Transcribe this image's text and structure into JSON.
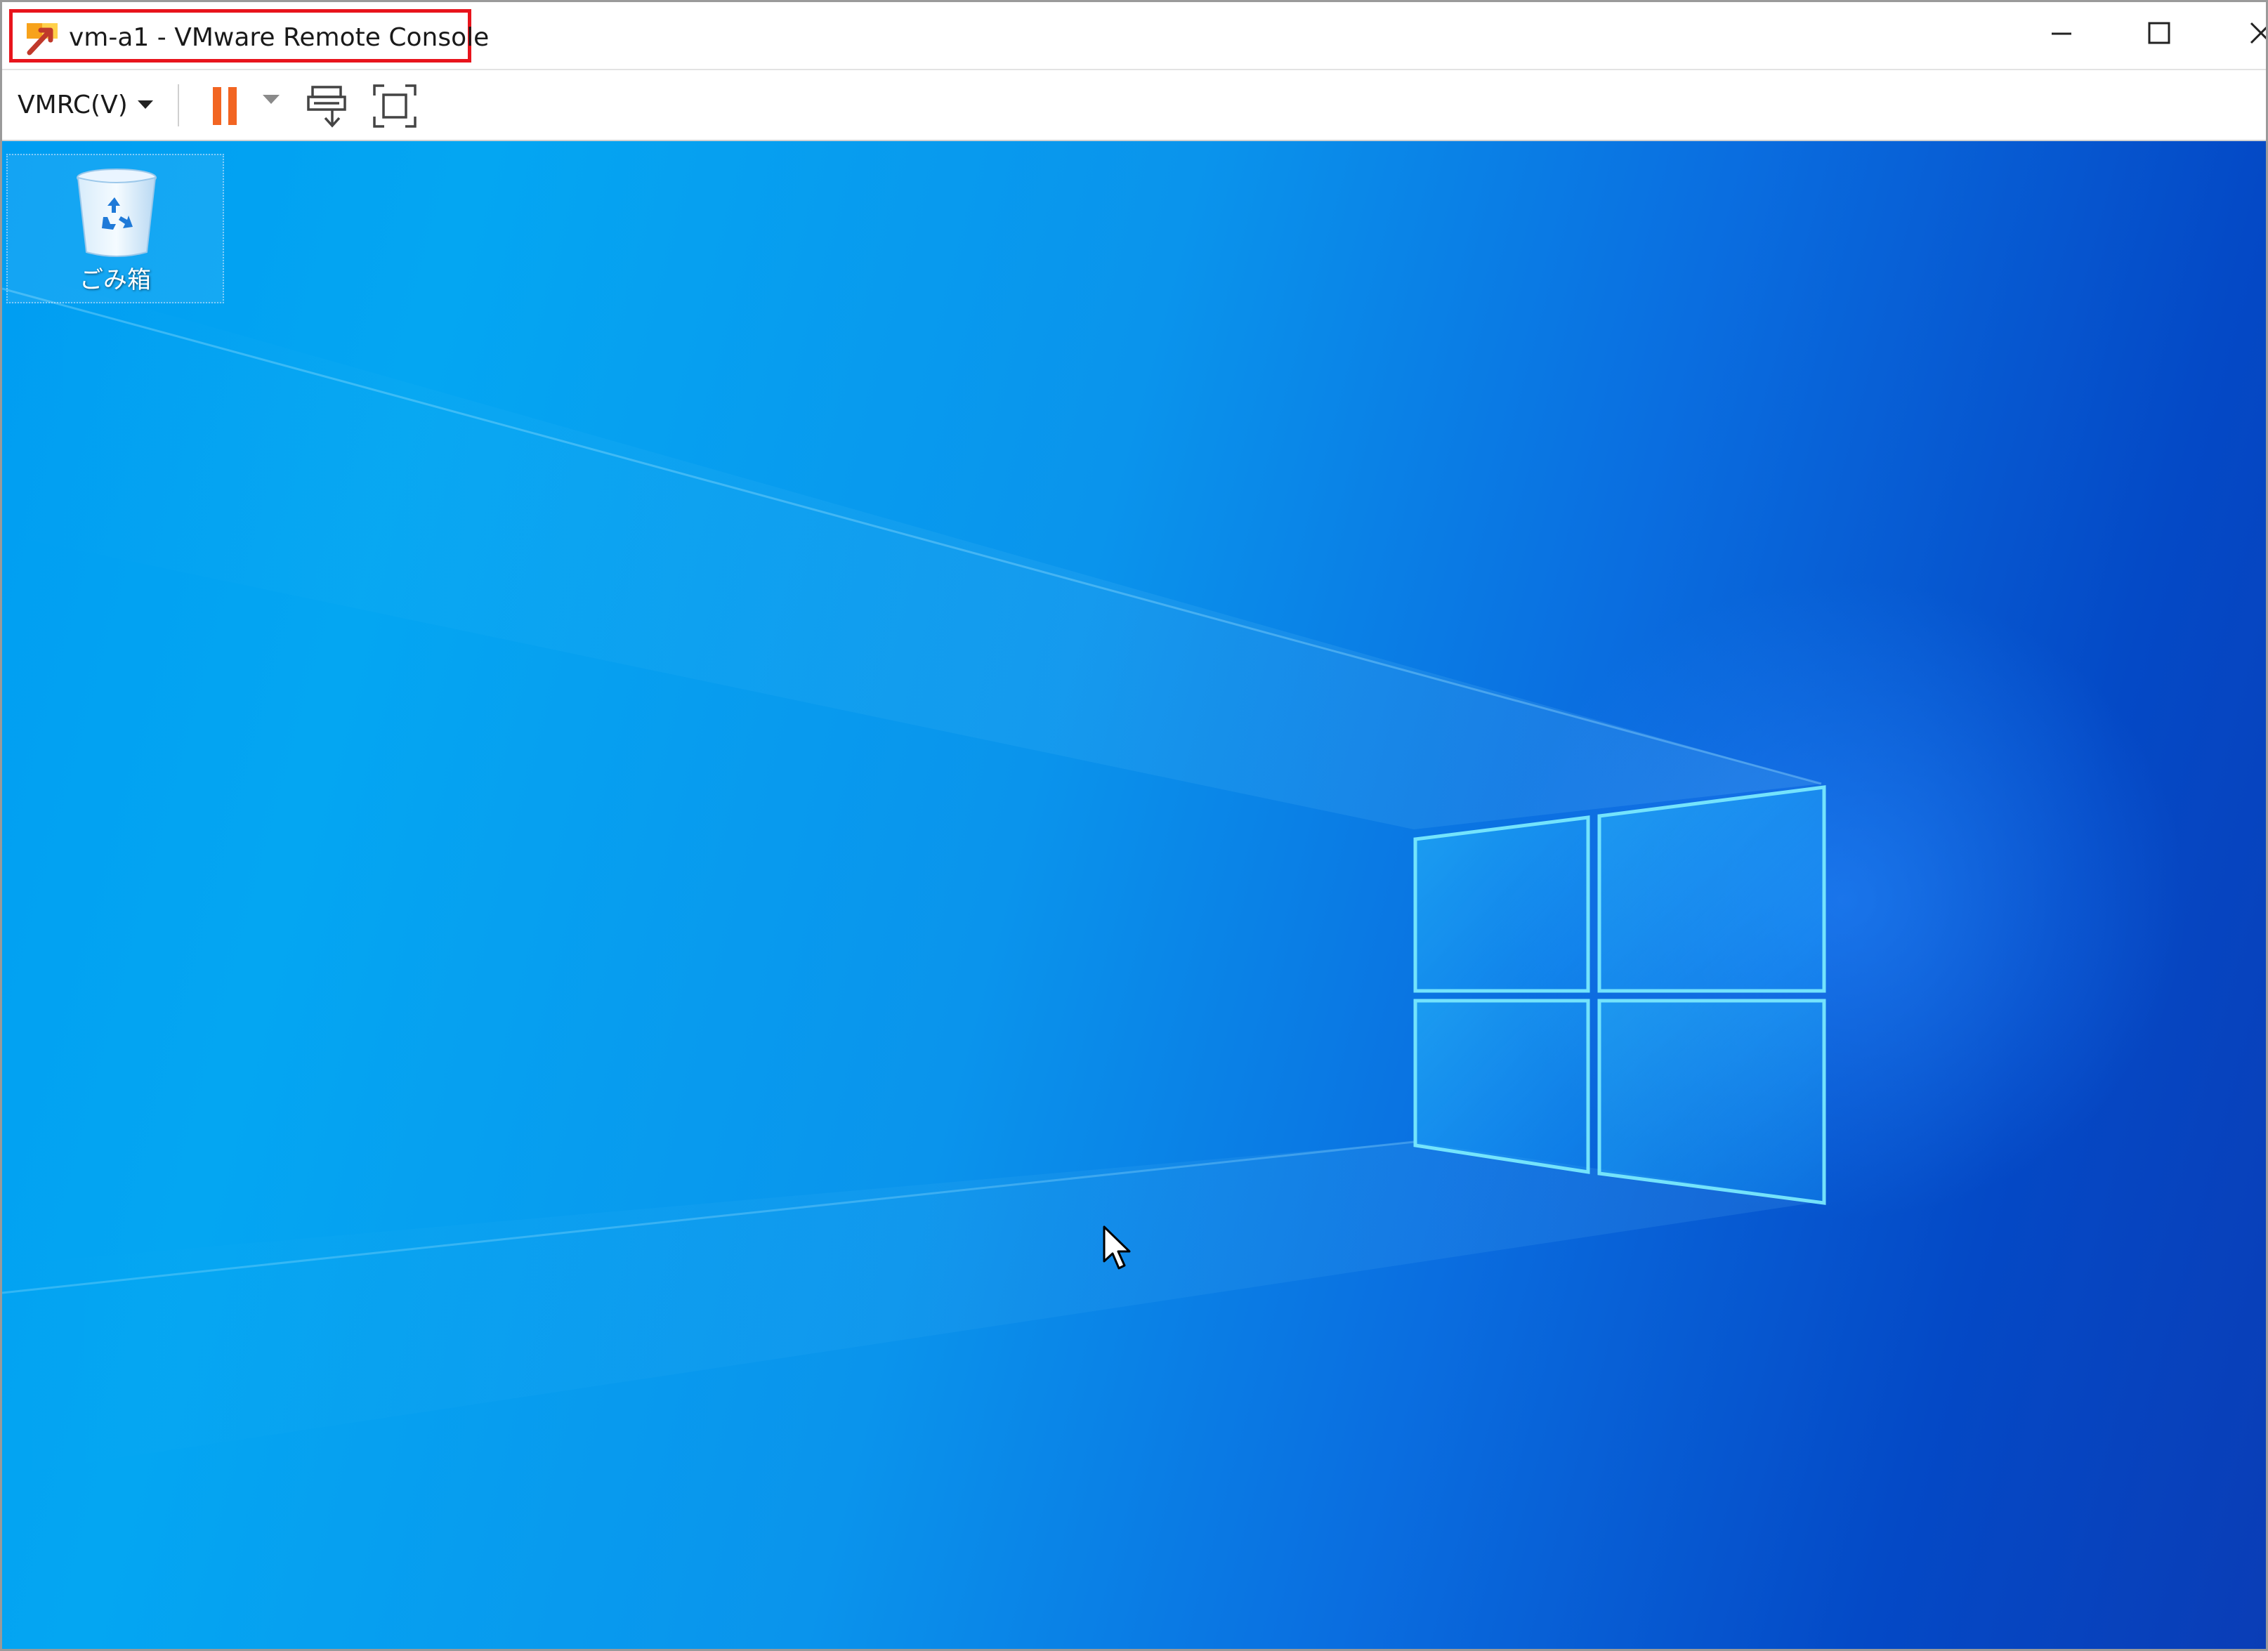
{
  "window": {
    "title": "vm-a1 - VMware Remote Console",
    "icon": "vmrc-app-icon",
    "controls": [
      "minimize-icon",
      "maximize-icon",
      "close-icon"
    ]
  },
  "toolbar": {
    "menu_label": "VMRC(V)",
    "menu_icon": "caret-down-icon",
    "buttons": [
      {
        "name": "pause",
        "icon": "pause-icon",
        "color": "#f26522"
      },
      {
        "name": "pause-dropdown",
        "icon": "caret-down-icon"
      },
      {
        "name": "send-ctrl-alt-del",
        "icon": "ctrl-alt-del-icon"
      },
      {
        "name": "fullscreen",
        "icon": "fullscreen-icon"
      }
    ]
  },
  "desktop": {
    "icons": [
      {
        "label": "ごみ箱",
        "icon": "recycle-bin-icon"
      }
    ]
  },
  "colors": {
    "highlight_border": "#e8141c",
    "pause_accent": "#f26522",
    "wallpaper_light": "#04a6f2",
    "wallpaper_dark": "#0a3db6"
  }
}
